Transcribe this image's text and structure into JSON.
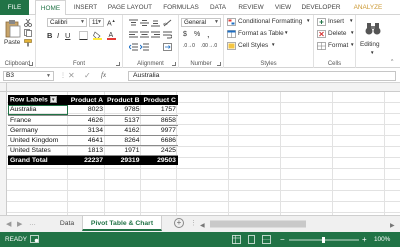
{
  "ribbon_tabs": [
    "FILE",
    "HOME",
    "INSERT",
    "PAGE LAYOUT",
    "FORMULAS",
    "DATA",
    "REVIEW",
    "VIEW",
    "DEVELOPER",
    "ANALYZE"
  ],
  "clipboard": {
    "paste_label": "Paste",
    "group_label": "Clipboard"
  },
  "font": {
    "name": "Calibri",
    "size": "11",
    "group_label": "Font"
  },
  "alignment": {
    "group_label": "Alignment"
  },
  "number": {
    "format": "General",
    "group_label": "Number",
    "currency": "$",
    "percent": "%",
    "comma": ",",
    "dec_inc": ".0→0",
    "dec_dec": ".00→.0"
  },
  "styles": {
    "conditional": "Conditional Formatting",
    "format_table": "Format as Table",
    "cell_styles": "Cell Styles",
    "group_label": "Styles"
  },
  "cells": {
    "insert": "Insert",
    "delete": "Delete",
    "format": "Format",
    "group_label": "Cells"
  },
  "editing": {
    "label": "Editing"
  },
  "formula_bar": {
    "name_box": "B3",
    "formula": "Australia"
  },
  "pivot": {
    "headers": [
      "Row Labels",
      "Product A",
      "Product B",
      "Product C"
    ],
    "rows": [
      [
        "Australia",
        "8023",
        "9785",
        "1757"
      ],
      [
        "France",
        "4626",
        "5137",
        "8658"
      ],
      [
        "Germany",
        "3134",
        "4162",
        "9977"
      ],
      [
        "United Kingdom",
        "4641",
        "8264",
        "6686"
      ],
      [
        "United States",
        "1813",
        "1971",
        "2425"
      ]
    ],
    "total": [
      "Grand Total",
      "22237",
      "29319",
      "29503"
    ]
  },
  "sheets": {
    "tabs": [
      "Data",
      "Pivot Table & Chart"
    ],
    "active": "Pivot Table & Chart"
  },
  "status": {
    "ready": "READY",
    "zoom": "100%"
  },
  "colors": {
    "accent": "#217346",
    "analyze_tab": "#cc9933",
    "pivot_header": "#000000"
  }
}
